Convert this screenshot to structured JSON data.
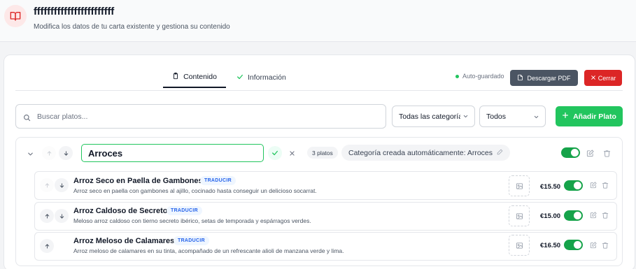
{
  "header": {
    "title": "ffffffffffffffffffffffff",
    "subtitle": "Modifica los datos de tu carta existente y gestiona su contenido"
  },
  "tabs": [
    {
      "label": "Contenido",
      "icon": "clipboard-icon",
      "active": true
    },
    {
      "label": "Información",
      "icon": "check-icon",
      "active": false
    }
  ],
  "toolbar": {
    "autosave_label": "Auto-guardado",
    "pdf_label": "Descargar PDF",
    "close_label": "Cerrar"
  },
  "filters": {
    "search_placeholder": "Buscar platos...",
    "category_value": "Todas las categorías",
    "status_value": "Todos",
    "add_label": "Añadir Plato"
  },
  "category": {
    "name_value": "Arroces",
    "count_label": "3 platos",
    "description": "Categoría creada automáticamente: Arroces",
    "active": true
  },
  "dishes": [
    {
      "name": "Arroz Seco en Paella de Gambones",
      "badge": "TRADUCIR",
      "description": "Arroz seco en paella con gambones al ajillo, cocinado hasta conseguir un delicioso socarrat.",
      "price": "€15.50",
      "active": true
    },
    {
      "name": "Arroz Caldoso de Secreto",
      "badge": "TRADUCIR",
      "description": "Meloso arroz caldoso con tierno secreto ibérico, setas de temporada y espárragos verdes.",
      "price": "€15.00",
      "active": true
    },
    {
      "name": "Arroz Meloso de Calamares",
      "badge": "TRADUCIR",
      "description": "Arroz meloso de calamares en su tinta, acompañado de un refrescante alioli de manzana verde y lima.",
      "price": "€16.50",
      "active": true
    }
  ],
  "colors": {
    "accent_green": "#22c55e",
    "danger_red": "#dc2626",
    "slate_button": "#4b5563",
    "badge_blue": "#2563eb"
  }
}
